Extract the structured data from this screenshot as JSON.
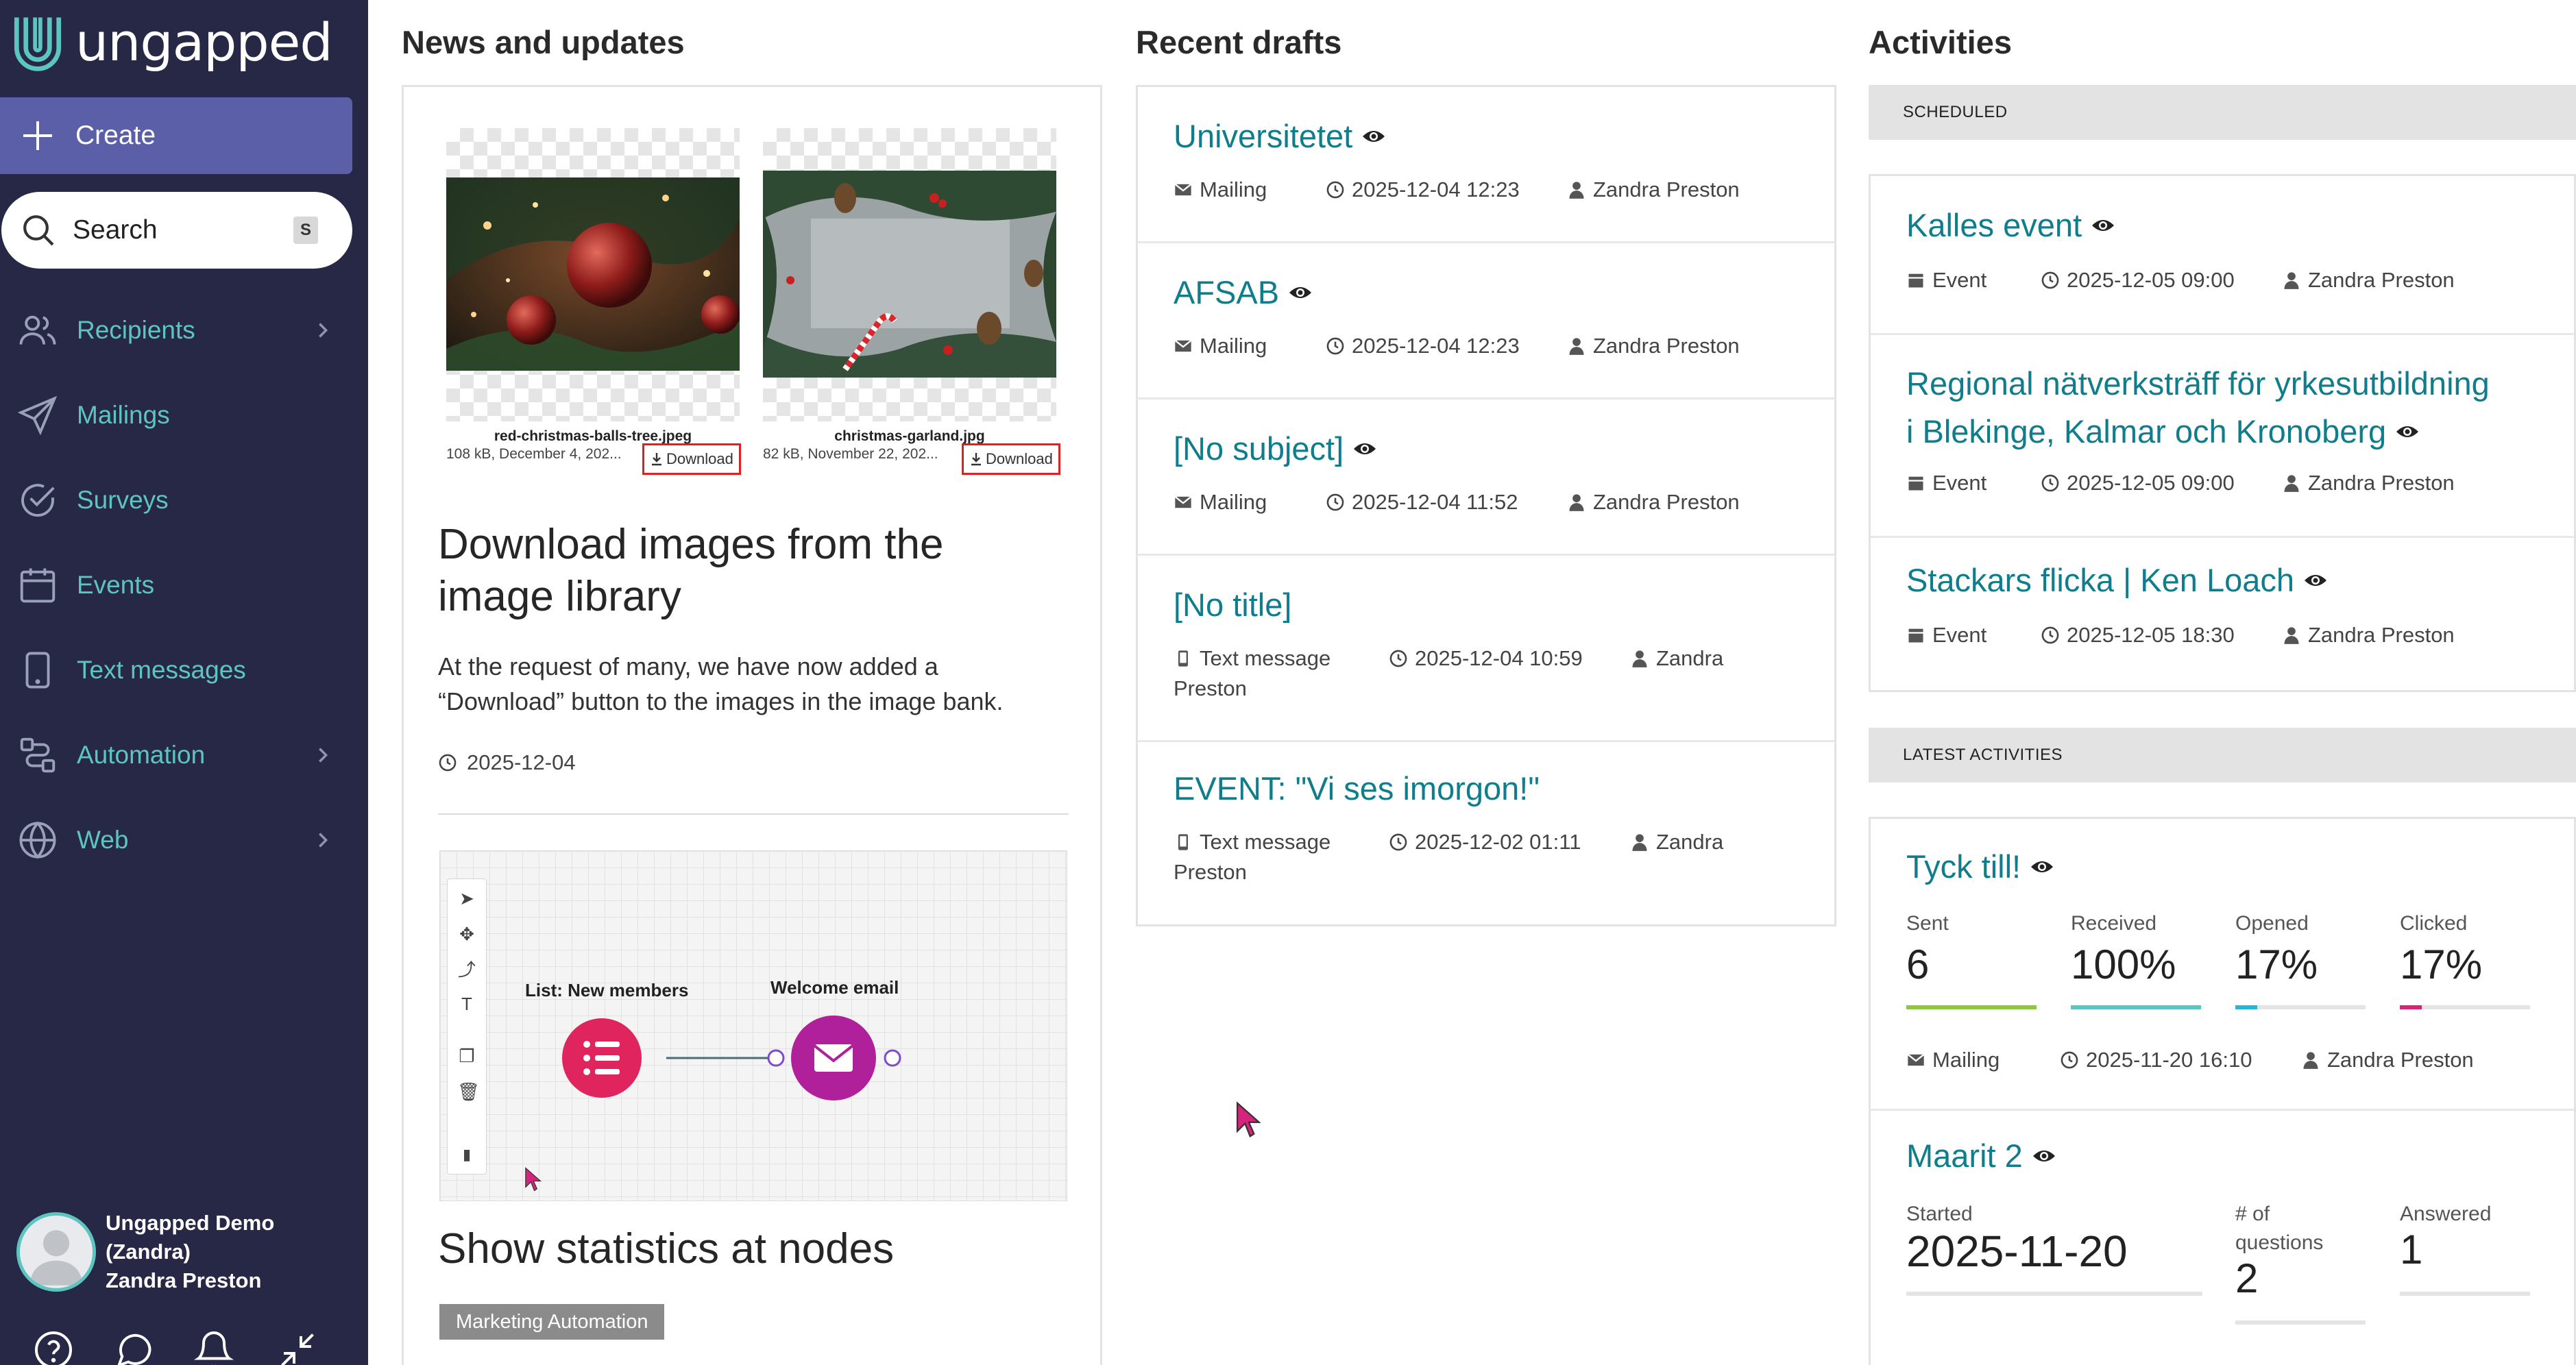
{
  "brand": {
    "name": "ungapped"
  },
  "sidebar": {
    "create_label": "Create",
    "search_label": "Search",
    "search_shortcut": "S",
    "items": [
      {
        "label": "Recipients",
        "icon": "users-icon",
        "has_submenu": true
      },
      {
        "label": "Mailings",
        "icon": "send-icon",
        "has_submenu": false
      },
      {
        "label": "Surveys",
        "icon": "check-circle-icon",
        "has_submenu": false
      },
      {
        "label": "Events",
        "icon": "calendar-icon",
        "has_submenu": false
      },
      {
        "label": "Text messages",
        "icon": "phone-icon",
        "has_submenu": false
      },
      {
        "label": "Automation",
        "icon": "automation-icon",
        "has_submenu": true
      },
      {
        "label": "Web",
        "icon": "globe-icon",
        "has_submenu": true
      }
    ],
    "user": {
      "line1": "Ungapped Demo",
      "line2": "(Zandra)",
      "line3": "Zandra Preston"
    }
  },
  "news": {
    "title": "News and updates",
    "images": [
      {
        "name": "red-christmas-balls-tree.jpeg",
        "meta": "108 kB, December 4, 202...",
        "download": "Download"
      },
      {
        "name": "christmas-garland.jpg",
        "meta": "82 kB, November 22, 202...",
        "download": "Download"
      }
    ],
    "article1": {
      "heading": "Download images from the image library",
      "body": "At the request of many, we have now added a “Download” button to the images in the image bank.",
      "date": "2025-12-04"
    },
    "flow": {
      "node1": "List: New members",
      "node2": "Welcome email"
    },
    "article2": {
      "heading": "Show statistics at nodes",
      "tag": "Marketing Automation"
    }
  },
  "drafts": {
    "title": "Recent drafts",
    "items": [
      {
        "title": "Universitetet",
        "type": "Mailing",
        "time": "2025-12-04 12:23",
        "user": "Zandra Preston"
      },
      {
        "title": "AFSAB",
        "type": "Mailing",
        "time": "2025-12-04 12:23",
        "user": "Zandra Preston"
      },
      {
        "title": "[No subject]",
        "type": "Mailing",
        "time": "2025-12-04 11:52",
        "user": "Zandra Preston"
      },
      {
        "title": "[No title]",
        "type": "Text message",
        "time": "2025-12-04 10:59",
        "user_a": "Zandra",
        "user_b": "Preston"
      },
      {
        "title": "EVENT: \"Vi ses imorgon!\"",
        "type": "Text message",
        "time": "2025-12-02 01:11",
        "user_a": "Zandra",
        "user_b": "Preston"
      }
    ]
  },
  "activities": {
    "title": "Activities",
    "scheduled_label": "SCHEDULED",
    "scheduled": [
      {
        "title": "Kalles event",
        "type": "Event",
        "time": "2025-12-05 09:00",
        "user": "Zandra Preston"
      },
      {
        "title_line1": "Regional nätverksträff för yrkesutbildning",
        "title_line2": "i Blekinge, Kalmar och Kronoberg",
        "type": "Event",
        "time": "2025-12-05 09:00",
        "user": "Zandra Preston"
      },
      {
        "title": "Stackars flicka | Ken Loach",
        "type": "Event",
        "time": "2025-12-05 18:30",
        "user": "Zandra Preston"
      }
    ],
    "latest_label": "LATEST ACTIVITIES",
    "latest_mailing": {
      "title": "Tyck till!",
      "stats": [
        {
          "label": "Sent",
          "value": "6",
          "fraction": 1.0,
          "color": "#8dc63f"
        },
        {
          "label": "Received",
          "value": "100%",
          "fraction": 1.0,
          "color": "#5dc5c0"
        },
        {
          "label": "Opened",
          "value": "17%",
          "fraction": 0.17,
          "color": "#29b6d6"
        },
        {
          "label": "Clicked",
          "value": "17%",
          "fraction": 0.17,
          "color": "#d6247c"
        }
      ],
      "type": "Mailing",
      "time": "2025-11-20 16:10",
      "user": "Zandra Preston"
    },
    "latest_survey": {
      "title": "Maarit 2",
      "started_label": "Started",
      "started_value": "2025-11-20",
      "questions_label_1": "# of",
      "questions_label_2": "questions",
      "questions_value": "2",
      "answered_label": "Answered",
      "answered_value": "1"
    }
  },
  "colors": {
    "sidebar_bg": "#272846",
    "accent": "#5dc5c0",
    "link": "#0f7d8c",
    "create_bg": "#5b5fa8"
  }
}
